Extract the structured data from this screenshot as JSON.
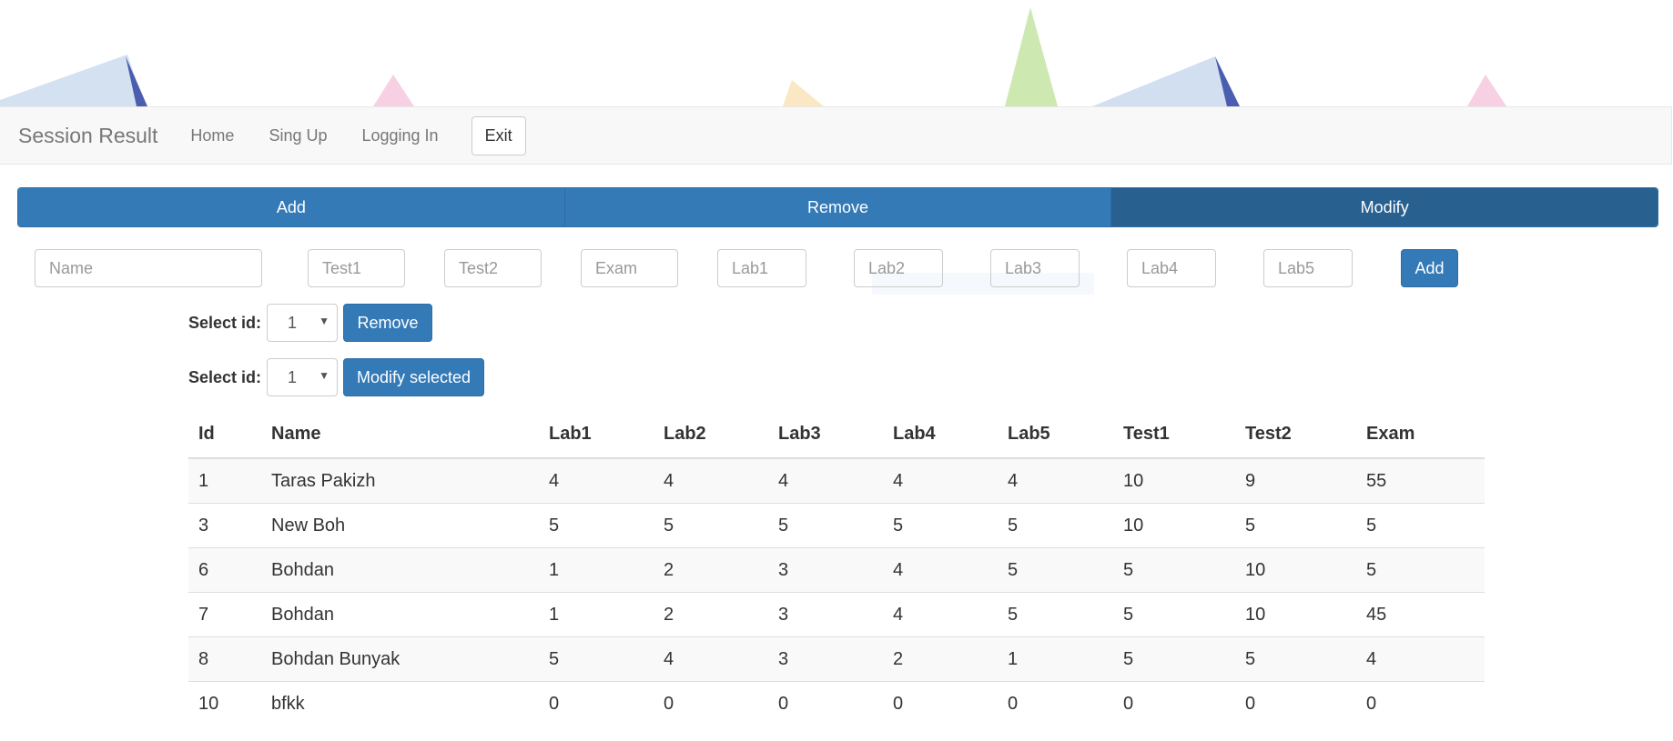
{
  "navbar": {
    "brand": "Session Result",
    "links": [
      "Home",
      "Sing Up",
      "Logging In"
    ],
    "exit_label": "Exit"
  },
  "tabs": [
    {
      "label": "Add",
      "active": false
    },
    {
      "label": "Remove",
      "active": false
    },
    {
      "label": "Modify",
      "active": true
    }
  ],
  "add_form": {
    "placeholders": {
      "name": "Name",
      "test1": "Test1",
      "test2": "Test2",
      "exam": "Exam",
      "lab1": "Lab1",
      "lab2": "Lab2",
      "lab3": "Lab3",
      "lab4": "Lab4",
      "lab5": "Lab5"
    },
    "submit_label": "Add"
  },
  "remove_form": {
    "label": "Select id:",
    "selected": "1",
    "button_label": "Remove"
  },
  "modify_form": {
    "label": "Select id:",
    "selected": "1",
    "button_label": "Modify selected"
  },
  "table": {
    "headers": [
      "Id",
      "Name",
      "Lab1",
      "Lab2",
      "Lab3",
      "Lab4",
      "Lab5",
      "Test1",
      "Test2",
      "Exam"
    ],
    "rows": [
      [
        "1",
        "Taras Pakizh",
        "4",
        "4",
        "4",
        "4",
        "4",
        "10",
        "9",
        "55"
      ],
      [
        "3",
        "New Boh",
        "5",
        "5",
        "5",
        "5",
        "5",
        "10",
        "5",
        "5"
      ],
      [
        "6",
        "Bohdan",
        "1",
        "2",
        "3",
        "4",
        "5",
        "5",
        "10",
        "5"
      ],
      [
        "7",
        "Bohdan",
        "1",
        "2",
        "3",
        "4",
        "5",
        "5",
        "10",
        "45"
      ],
      [
        "8",
        "Bohdan Bunyak",
        "5",
        "4",
        "3",
        "2",
        "1",
        "5",
        "5",
        "4"
      ],
      [
        "10",
        "bfkk",
        "0",
        "0",
        "0",
        "0",
        "0",
        "0",
        "0",
        "0"
      ]
    ]
  },
  "colors": {
    "primary": "#337ab7",
    "primary_active": "#286090",
    "navbar_bg": "#f8f8f8"
  }
}
